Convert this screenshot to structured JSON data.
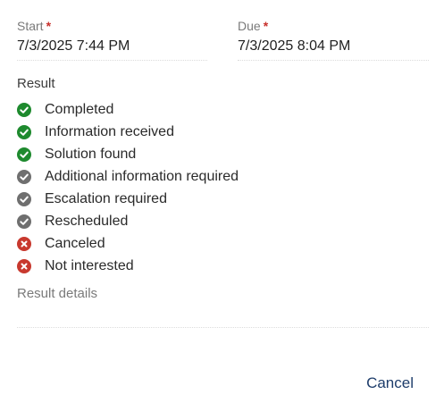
{
  "start": {
    "label": "Start",
    "required_mark": "*",
    "value": "7/3/2025 7:44 PM"
  },
  "due": {
    "label": "Due",
    "required_mark": "*",
    "value": "7/3/2025 8:04 PM"
  },
  "result": {
    "label": "Result",
    "options": [
      {
        "label": "Completed",
        "status": "success",
        "icon": "check-circle-icon"
      },
      {
        "label": "Information received",
        "status": "success",
        "icon": "check-circle-icon"
      },
      {
        "label": "Solution found",
        "status": "success",
        "icon": "check-circle-icon"
      },
      {
        "label": "Additional information required",
        "status": "neutral",
        "icon": "check-circle-icon"
      },
      {
        "label": "Escalation required",
        "status": "neutral",
        "icon": "check-circle-icon"
      },
      {
        "label": "Rescheduled",
        "status": "neutral",
        "icon": "check-circle-icon"
      },
      {
        "label": "Canceled",
        "status": "fail",
        "icon": "x-circle-icon"
      },
      {
        "label": "Not interested",
        "status": "fail",
        "icon": "x-circle-icon"
      }
    ]
  },
  "details": {
    "label": "Result details",
    "value": ""
  },
  "footer": {
    "cancel_label": "Cancel"
  },
  "colors": {
    "success": "#1e8a2e",
    "neutral": "#6f6f6f",
    "fail": "#c8392e",
    "required": "#c8312c",
    "link": "#1e3d6b"
  }
}
